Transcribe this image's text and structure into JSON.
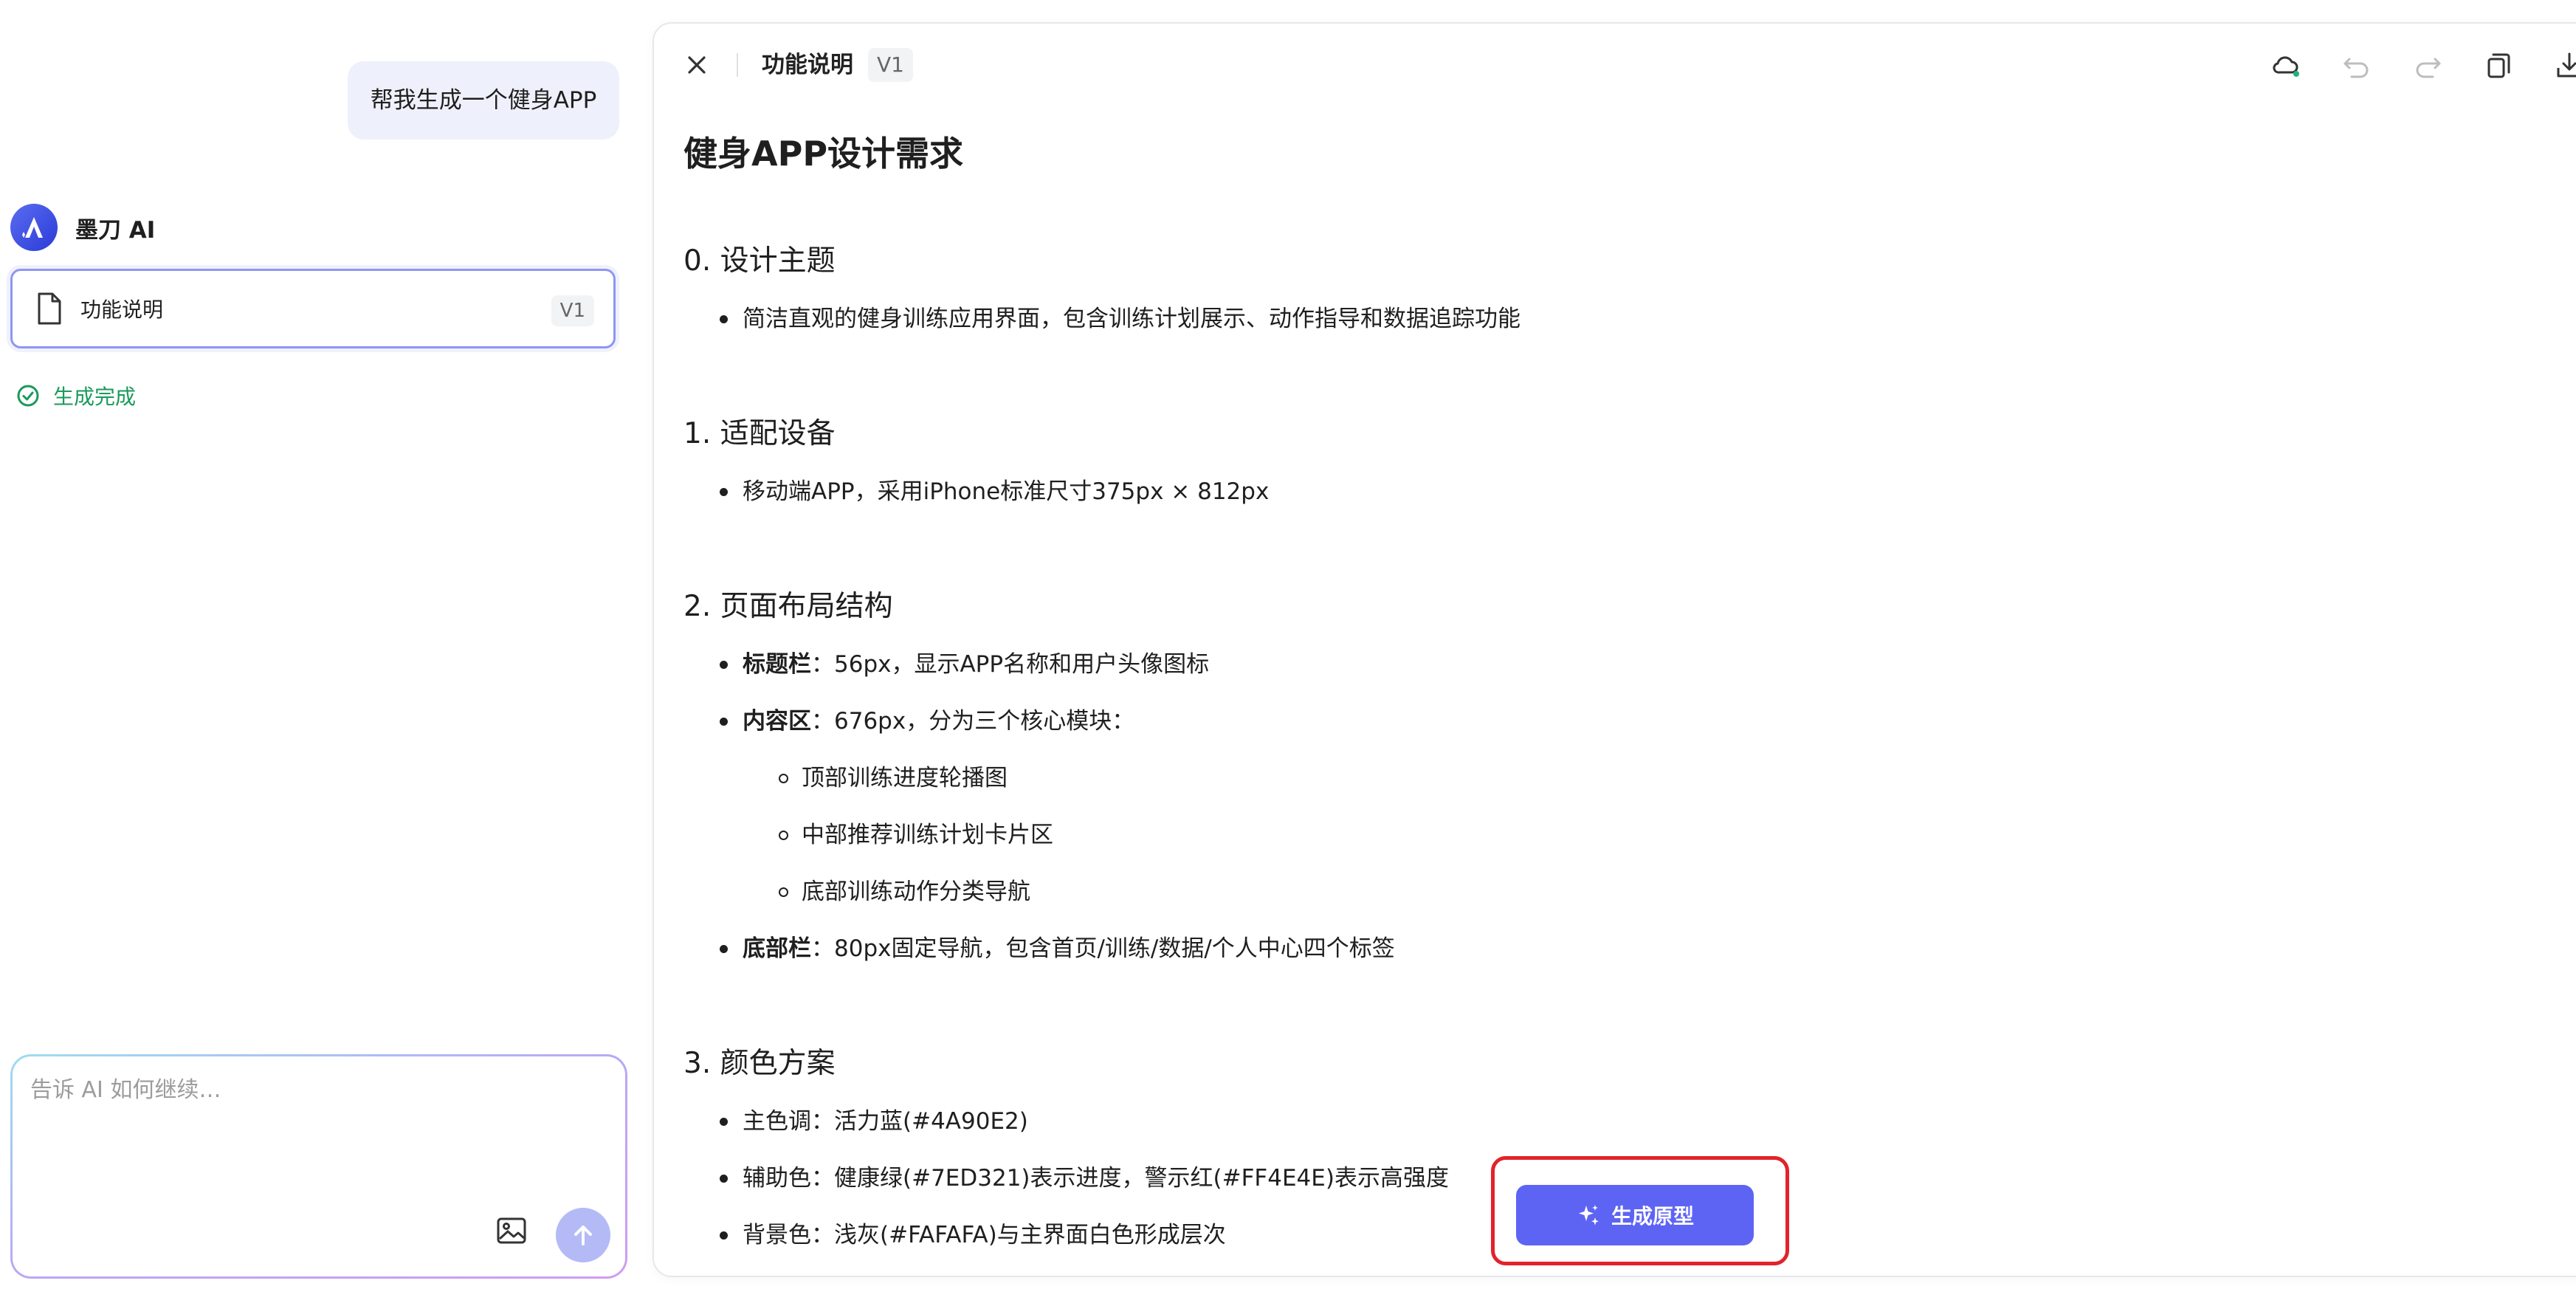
{
  "chat": {
    "user_message": "帮我生成一个健身APP",
    "ai_name": "墨刀 AI",
    "doc_card": {
      "title": "功能说明",
      "version": "V1"
    },
    "status": "生成完成",
    "input_placeholder": "告诉 AI 如何继续…"
  },
  "doc": {
    "title": "功能说明",
    "version": "V1",
    "heading": "健身APP设计需求",
    "s0": {
      "title": "0. 设计主题",
      "item": "简洁直观的健身训练应用界面，包含训练计划展示、动作指导和数据追踪功能"
    },
    "s1": {
      "title": "1. 适配设备",
      "item": "移动端APP，采用iPhone标准尺寸375px × 812px"
    },
    "s2": {
      "title": "2. 页面布局结构",
      "title_bar_label": "标题栏",
      "title_bar_text": "：56px，显示APP名称和用户头像图标",
      "content_label": "内容区",
      "content_text": "：676px，分为三个核心模块：",
      "sub1": "顶部训练进度轮播图",
      "sub2": "中部推荐训练计划卡片区",
      "sub3": "底部训练动作分类导航",
      "bottom_label": "底部栏",
      "bottom_text": "：80px固定导航，包含首页/训练/数据/个人中心四个标签"
    },
    "s3": {
      "title": "3. 颜色方案",
      "primary": "主色调：活力蓝(#4A90E2)",
      "secondary": "辅助色：健康绿(#7ED321)表示进度，警示红(#FF4E4E)表示高强度",
      "background": "背景色：浅灰(#FAFAFA)与主界面白色形成层次"
    }
  },
  "generate_button_label": "生成原型",
  "colors": {
    "accent": "#5d64f4",
    "success": "#1a9a5b",
    "highlight": "#e2232b"
  }
}
